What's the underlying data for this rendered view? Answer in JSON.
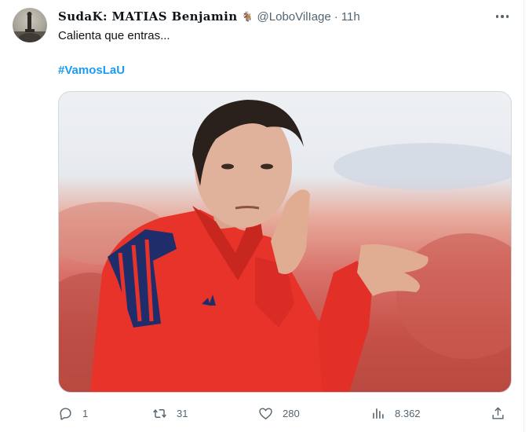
{
  "tweet": {
    "author": {
      "display_name": "SudaK: MATIAS Benjamin",
      "name_emoji": "🐐",
      "handle": "@LoboVilIage",
      "separator": "·",
      "time": "11h"
    },
    "text": "Calienta que entras...",
    "hashtag": "#VamosLaU",
    "media": {
      "description_icon": "photo-icon",
      "colors": {
        "jacket": "#e8332b",
        "stripes": "#1f2e6b",
        "background_red": "#d9726a"
      }
    },
    "actions": {
      "reply": {
        "icon": "reply-icon",
        "count": "1"
      },
      "retweet": {
        "icon": "retweet-icon",
        "count": "31"
      },
      "like": {
        "icon": "like-icon",
        "count": "280"
      },
      "views": {
        "icon": "views-icon",
        "count": "8.362"
      },
      "share": {
        "icon": "share-icon"
      }
    }
  }
}
